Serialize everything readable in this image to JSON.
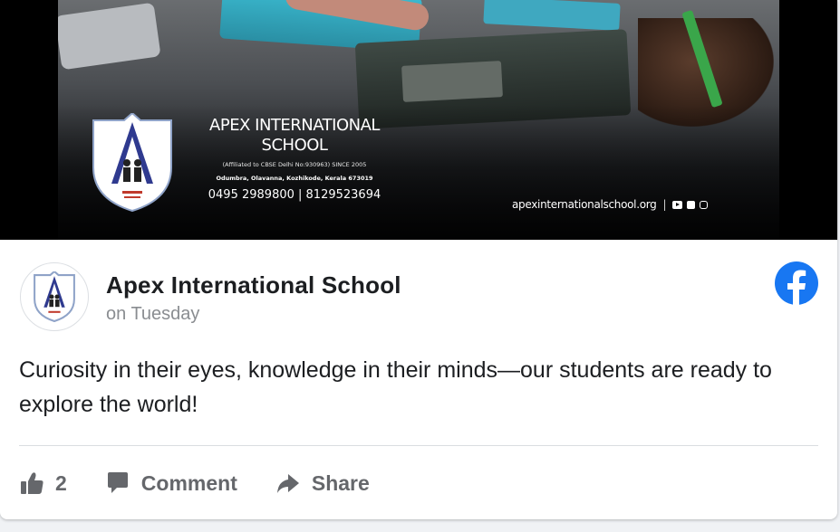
{
  "banner": {
    "school_name_line1": "APEX INTERNATIONAL",
    "school_name_line2": "SCHOOL",
    "affiliation": "(Affiliated to CBSE Delhi No:930963) SINCE 2005",
    "address": "Odumbra, Olavanna, Kozhikode, Kerala 673019",
    "phones": "0495 2989800 | 8129523694",
    "website": "apexinternationalschool.org",
    "separator": "|",
    "social_icons": [
      "youtube-icon",
      "facebook-icon",
      "instagram-icon"
    ]
  },
  "post": {
    "page_name": "Apex International School",
    "time": "on Tuesday",
    "text": "Curiosity in their eyes, knowledge in their minds—our students are ready to explore the world!",
    "platform_icon": "facebook-logo-icon"
  },
  "actions": {
    "like_count": "2",
    "comment_label": "Comment",
    "share_label": "Share"
  },
  "colors": {
    "facebook_blue": "#1877f2",
    "action_gray": "#65676b",
    "name_text": "#1c1e21",
    "time_text": "#8a8d91",
    "crest_blue": "#2f3a8f"
  }
}
